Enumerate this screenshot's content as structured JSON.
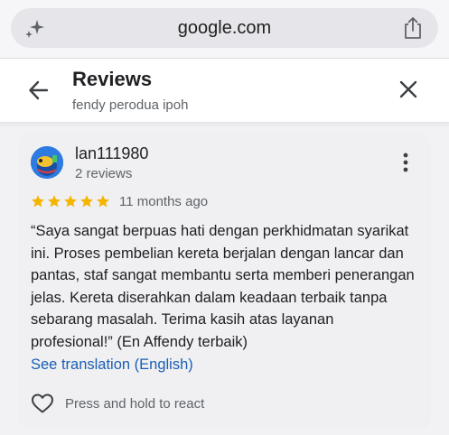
{
  "browser": {
    "url": "google.com",
    "left_icon": "sparkle-icon",
    "right_icon": "share-icon"
  },
  "header": {
    "title": "Reviews",
    "subtitle": "fendy perodua ipoh",
    "back_icon": "back-arrow-icon",
    "close_icon": "close-icon"
  },
  "review": {
    "reviewer_name": "lan111980",
    "reviewer_review_count": "2 reviews",
    "rating": 5,
    "max_rating": 5,
    "time": "11 months ago",
    "text": "“Saya sangat berpuas hati dengan perkhidmatan syarikat ini. Proses pembelian kereta berjalan dengan lancar dan pantas, staf sangat membantu serta memberi penerangan jelas. Kereta diserahkan dalam keadaan terbaik tanpa sebarang masalah. Terima kasih atas layanan profesional!” (En Affendy terbaik)",
    "translate_label": "See translation (English)",
    "react_label": "Press and hold to react"
  },
  "colors": {
    "star": "#f4b400",
    "link": "#1a5fb4",
    "card_bg": "#f0f0f2"
  }
}
